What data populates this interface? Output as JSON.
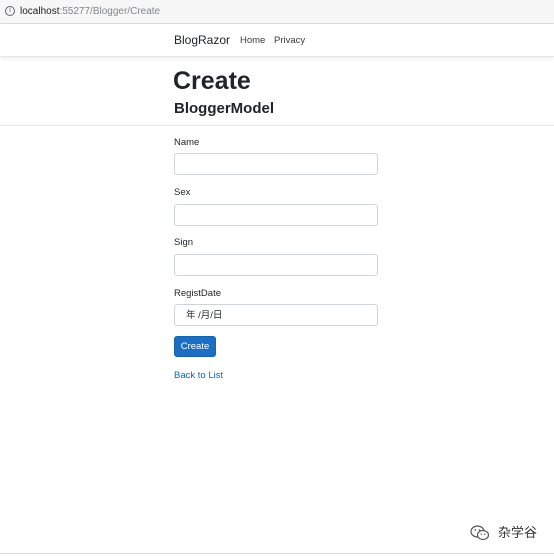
{
  "browser": {
    "url_host": "localhost",
    "url_rest": ":55277/Blogger/Create",
    "info_icon": "info-circle-icon"
  },
  "navbar": {
    "brand": "BlogRazor",
    "links": [
      "Home",
      "Privacy"
    ]
  },
  "page": {
    "title": "Create",
    "subtitle": "BloggerModel"
  },
  "form": {
    "fields": [
      {
        "label": "Name",
        "value": ""
      },
      {
        "label": "Sex",
        "value": ""
      },
      {
        "label": "Sign",
        "value": ""
      },
      {
        "label": "RegistDate",
        "value": "年 /月/日"
      }
    ],
    "submit_label": "Create",
    "back_link": "Back to List"
  },
  "watermark": {
    "text": "杂学谷",
    "icon": "wechat-icon"
  },
  "colors": {
    "primary_button": "#1b6ec2",
    "link": "#0366d6"
  }
}
